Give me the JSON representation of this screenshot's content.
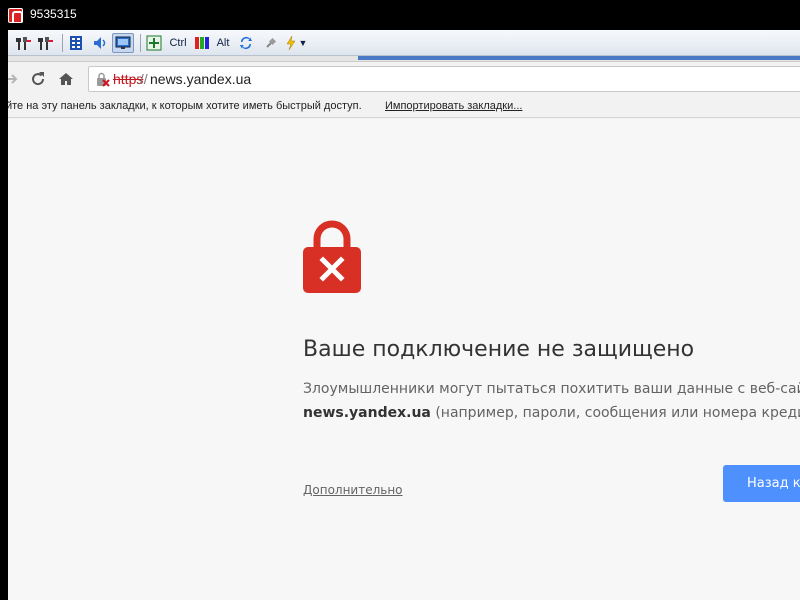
{
  "window": {
    "title": "9535315"
  },
  "remote_toolbar": {
    "ctrl_label": "Ctrl",
    "alt_label": "Alt",
    "buttons": [
      "tools-icon",
      "tools-settings-icon",
      "list-icon",
      "speaker-icon",
      "monitor-icon",
      "fullscreen-icon",
      "ctrl-key",
      "color-icon",
      "alt-key",
      "refresh-icon",
      "plug-icon",
      "lightning-icon"
    ]
  },
  "browser": {
    "url": {
      "scheme": "https",
      "separator": "://",
      "host": "news.yandex.ua"
    },
    "bookmarks": {
      "hint": "йте на эту панель закладки, к которым хотите иметь быстрый доступ.",
      "import_link": "Импортировать закладки..."
    }
  },
  "interstitial": {
    "heading": "Ваше подключение не защищено",
    "description_line1": "Злоумышленники могут пытаться похитить ваши данные с веб-сайта",
    "description_host": "news.yandex.ua",
    "description_line2": "(например, пароли, сообщения или номера кредитных",
    "advanced_link": "Дополнительно",
    "back_button": "Назад к",
    "colors": {
      "error_red": "#d93025",
      "button_blue": "#4d90fe",
      "heading": "#333333",
      "body_text": "#646464"
    }
  }
}
